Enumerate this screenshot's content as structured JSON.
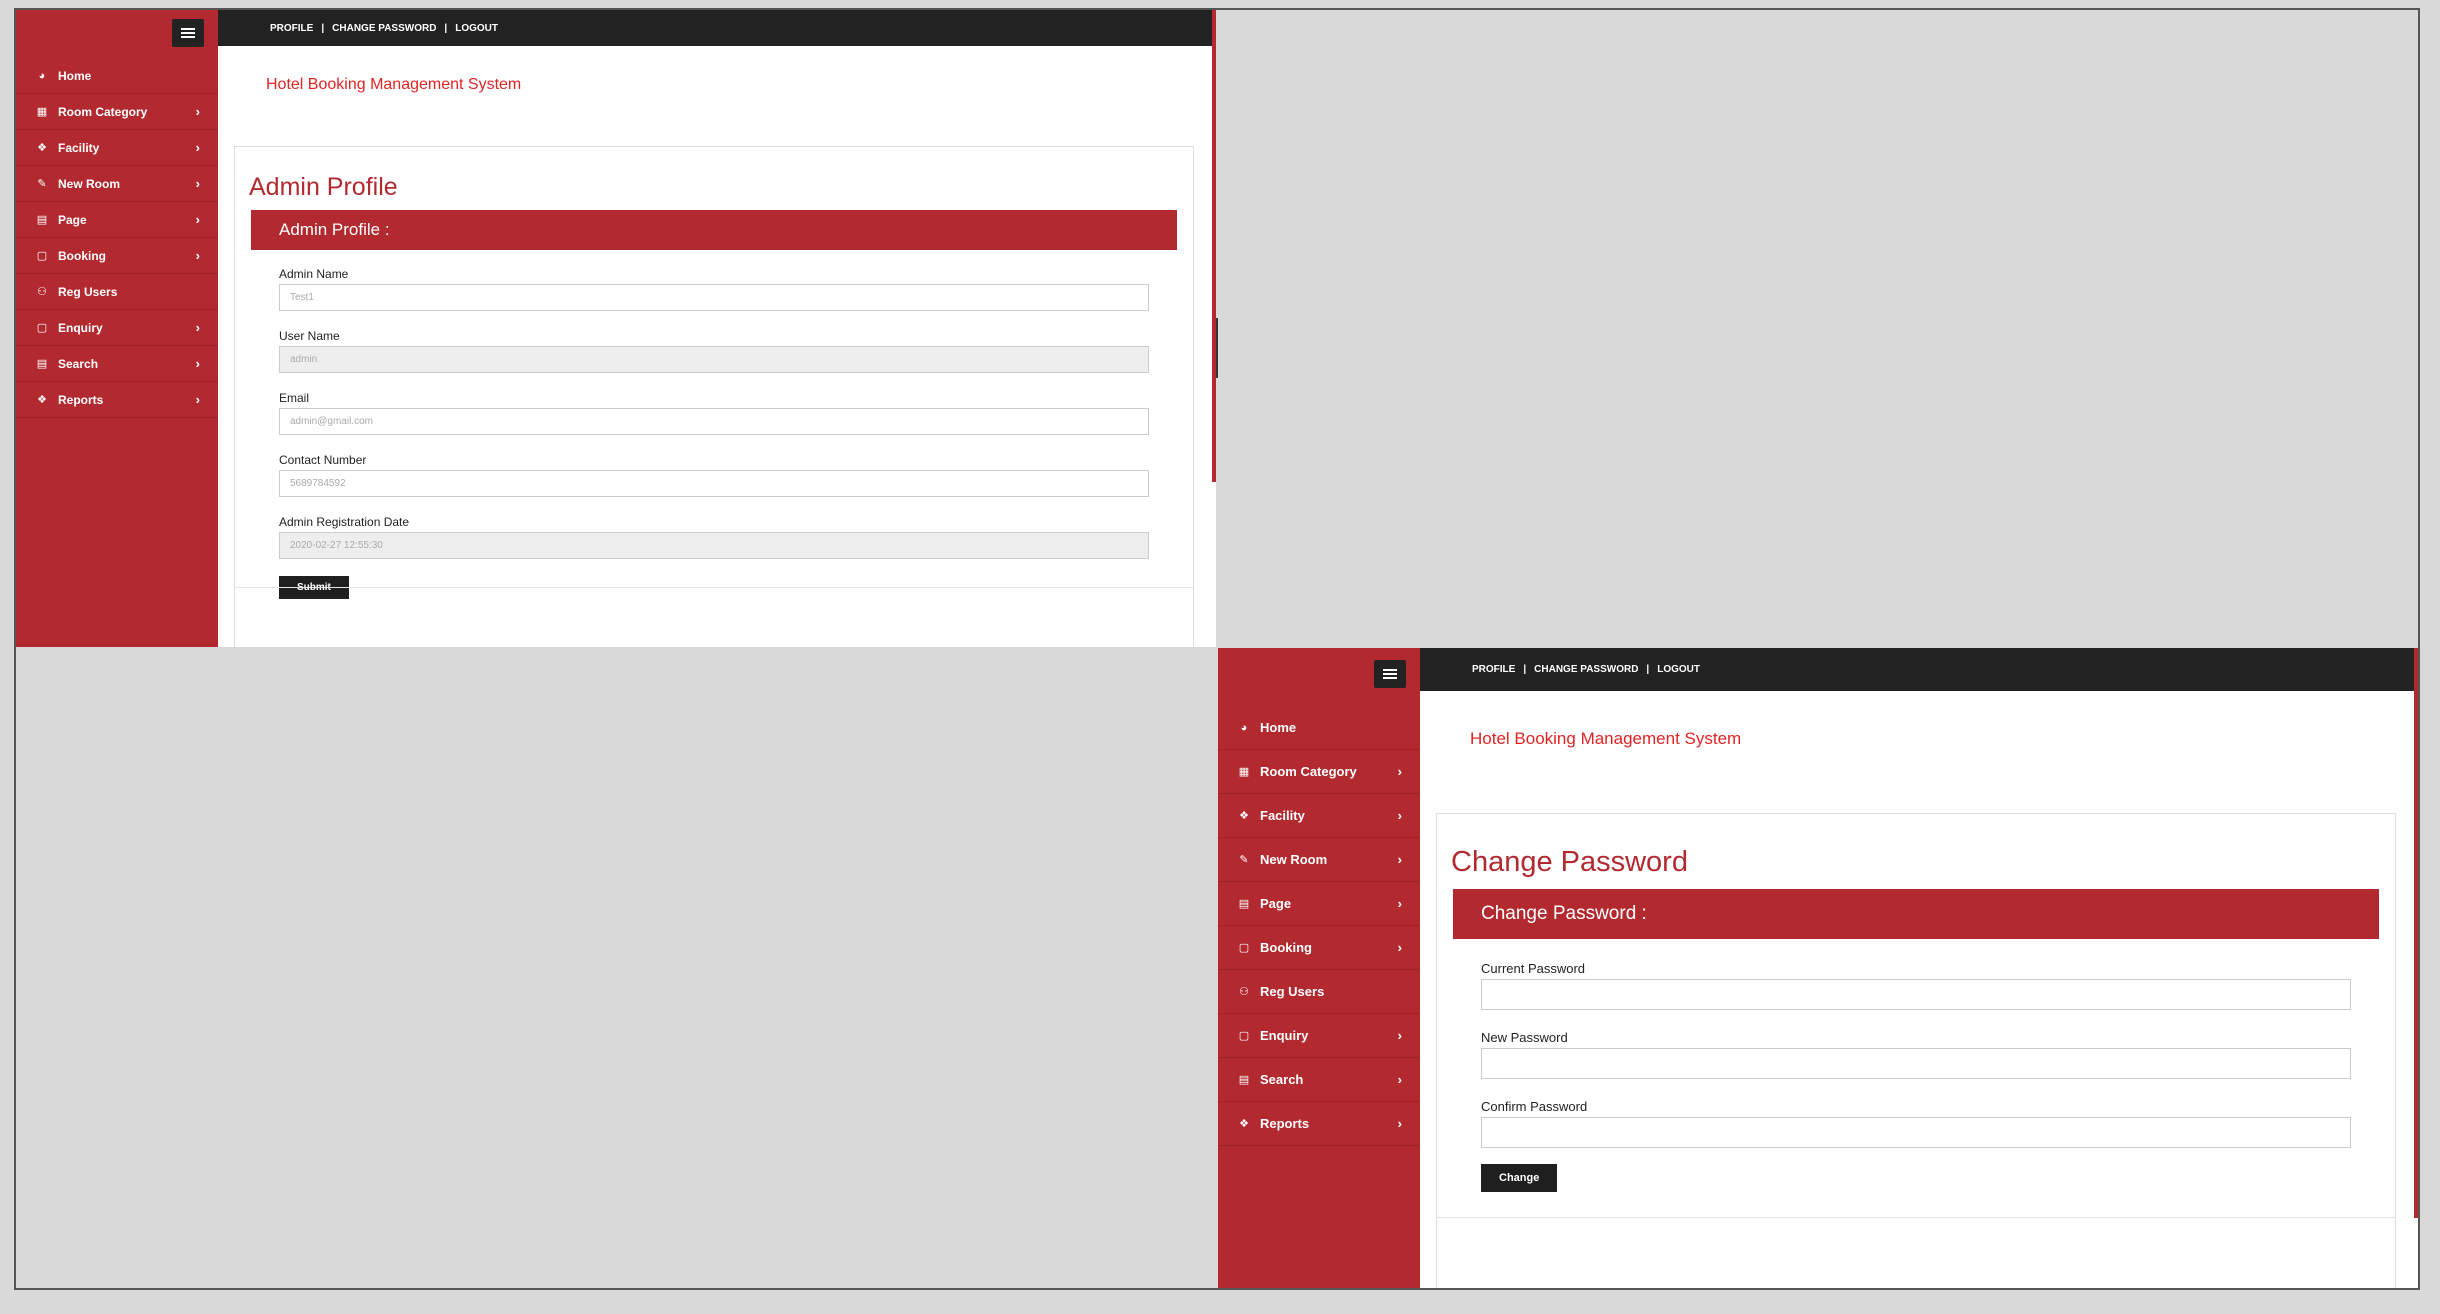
{
  "brand_color": "#b22a30",
  "title_color": "#e02424",
  "sidebar": {
    "items": [
      {
        "label": "Home",
        "icon": "dashboard-icon",
        "glyph": "◕",
        "submenu": false
      },
      {
        "label": "Room Category",
        "icon": "table-icon",
        "glyph": "▦",
        "submenu": true
      },
      {
        "label": "Facility",
        "icon": "layers-icon",
        "glyph": "❖",
        "submenu": true
      },
      {
        "label": "New Room",
        "icon": "pencil-icon",
        "glyph": "✎",
        "submenu": true
      },
      {
        "label": "Page",
        "icon": "file-icon",
        "glyph": "▤",
        "submenu": true
      },
      {
        "label": "Booking",
        "icon": "book-icon",
        "glyph": "▢",
        "submenu": true
      },
      {
        "label": "Reg Users",
        "icon": "users-icon",
        "glyph": "⚇",
        "submenu": false
      },
      {
        "label": "Enquiry",
        "icon": "book-icon",
        "glyph": "▢",
        "submenu": true
      },
      {
        "label": "Search",
        "icon": "file-icon",
        "glyph": "▤",
        "submenu": true
      },
      {
        "label": "Reports",
        "icon": "layers-icon",
        "glyph": "❖",
        "submenu": true
      }
    ],
    "chevron": "›"
  },
  "topbar": {
    "profile": "PROFILE",
    "change_password": "CHANGE PASSWORD",
    "logout": "LOGOUT",
    "sep": "|"
  },
  "app_title": "Hotel Booking Management System",
  "profile_page": {
    "heading": "Admin Profile",
    "card_header": "Admin Profile :",
    "fields": {
      "admin_name": {
        "label": "Admin Name",
        "value": "Test1"
      },
      "user_name": {
        "label": "User Name",
        "value": "admin"
      },
      "email": {
        "label": "Email",
        "value": "admin@gmail.com"
      },
      "contact": {
        "label": "Contact Number",
        "value": "5689784592"
      },
      "reg_date": {
        "label": "Admin Registration Date",
        "value": "2020-02-27 12:55:30"
      }
    },
    "submit": "Submit"
  },
  "password_page": {
    "heading": "Change Password",
    "card_header": "Change Password :",
    "fields": {
      "current": {
        "label": "Current Password",
        "value": ""
      },
      "new": {
        "label": "New Password",
        "value": ""
      },
      "confirm": {
        "label": "Confirm Password",
        "value": ""
      }
    },
    "submit": "Change"
  }
}
